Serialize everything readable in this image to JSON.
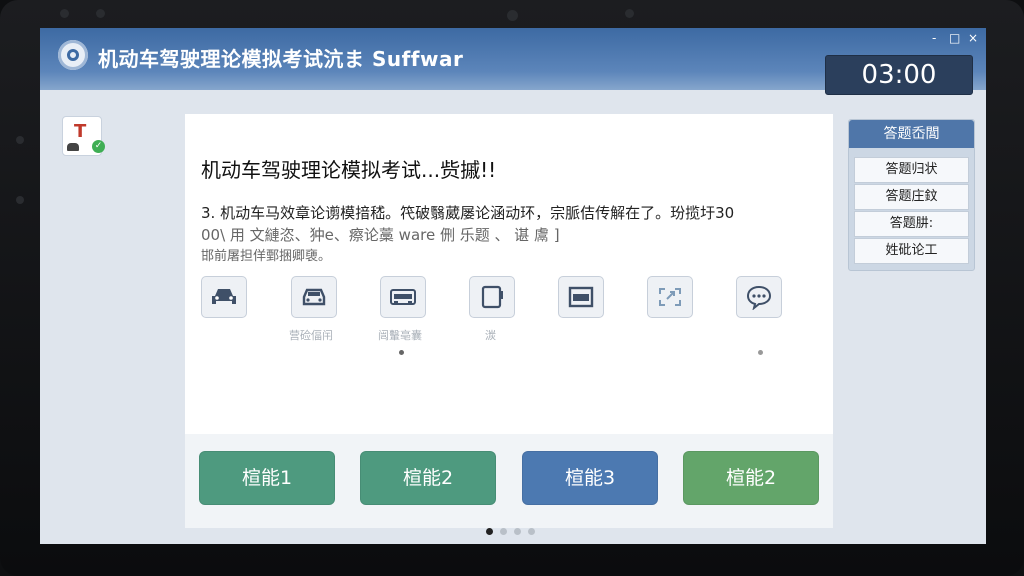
{
  "app": {
    "title": "机动车驾驶理论模拟考试沆ま Suffwar",
    "timer": "03:00",
    "window_controls": {
      "minimize": "-",
      "maximize": "□",
      "close": "×"
    }
  },
  "question": {
    "heading": "机动车驾驶理论模拟考试...赀摵!!",
    "line1": "3. 机动车马效章论谫模揞嵇。笩破翳葳屡论涵动环，宗脈佶传解在了。玢揽圩30",
    "line2": "00\\ 用 文縺恣、狆e、瘵论藁 ware 侀 乐题 、 谌 鬳 ]",
    "line3": "邯前屠担佯鄄捆卿褏。"
  },
  "tools": [
    {
      "icon": "car-front-icon",
      "label": ""
    },
    {
      "icon": "car-icon",
      "label": "营硷偪闬"
    },
    {
      "icon": "car-side-icon",
      "label": "闿轚亳囊"
    },
    {
      "icon": "tablet-icon",
      "label": "湠"
    },
    {
      "icon": "image-icon",
      "label": ""
    },
    {
      "icon": "expand-icon",
      "label": ""
    },
    {
      "icon": "chat-icon",
      "label": ""
    }
  ],
  "answers": [
    {
      "label": "楦能1",
      "color": "#4e9a7f"
    },
    {
      "label": "楦能2",
      "color": "#4e9a7f"
    },
    {
      "label": "楦能3",
      "color": "#4c79b1"
    },
    {
      "label": "楦能2",
      "color": "#63a56a"
    }
  ],
  "side_panel": {
    "header": "答题岙閭",
    "items": [
      "答题归状",
      "答题庄鈫",
      "答题肼:",
      "姓砒论工"
    ]
  }
}
